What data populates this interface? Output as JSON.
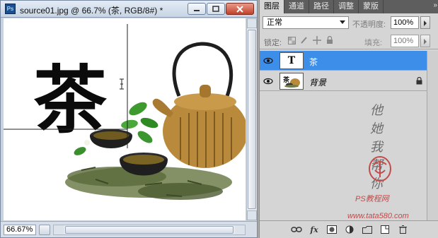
{
  "document": {
    "app_icon": "photoshop-icon",
    "title": "source01.jpg @ 66.7% (茶, RGB/8#) *",
    "window_buttons": [
      "minimize-icon",
      "restore-icon",
      "close-icon"
    ],
    "canvas_text": "茶",
    "zoom": "66.67%"
  },
  "panel": {
    "tabs": [
      "图层",
      "通道",
      "路径",
      "调整",
      "蒙版"
    ],
    "active_tab": "图层",
    "collapse_glyph": "»",
    "blend_mode": "正常",
    "opacity_label": "不透明度:",
    "opacity_value": "100%",
    "lock_label": "锁定:",
    "fill_label": "填充:",
    "fill_value": "100%",
    "layers": [
      {
        "name": "茶",
        "thumb": "T",
        "selected": true
      },
      {
        "name": "背景",
        "locked": true,
        "selected": false
      }
    ],
    "footer_icons": [
      "link-icon",
      "fx-icon",
      "mask-icon",
      "adjustment-icon",
      "group-icon",
      "new-layer-icon",
      "trash-icon"
    ]
  },
  "watermark": {
    "script": "他她我帮你",
    "caption": "PS教程网",
    "url": "www.tata580.com"
  },
  "colors": {
    "selection": "#3c8ee8",
    "panel_bg": "#d5d5d5",
    "tab_bar": "#5e5e5e",
    "watermark_red": "#c24b4b"
  }
}
